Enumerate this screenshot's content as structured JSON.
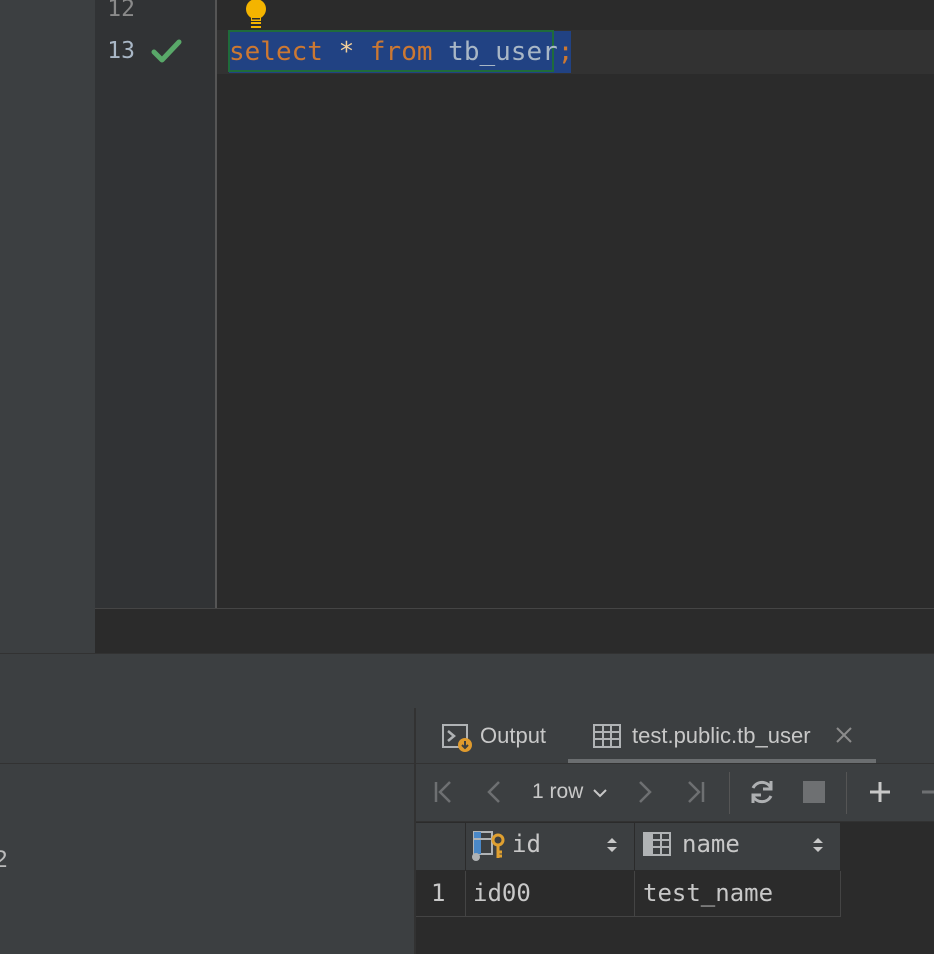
{
  "editor": {
    "line_numbers": [
      "12",
      "13"
    ],
    "code_tokens": [
      {
        "text": "select",
        "kind": "keyword"
      },
      {
        "text": " ",
        "kind": "space"
      },
      {
        "text": "*",
        "kind": "operator"
      },
      {
        "text": " ",
        "kind": "space"
      },
      {
        "text": "from",
        "kind": "keyword"
      },
      {
        "text": " ",
        "kind": "space"
      },
      {
        "text": "tb_user",
        "kind": "identifier"
      },
      {
        "text": ";",
        "kind": "keyword"
      }
    ],
    "gutter_icons": [
      "checkmark-icon",
      "lightbulb-icon"
    ]
  },
  "services_tree": {
    "visible_fragment": "2"
  },
  "results": {
    "tabs": [
      {
        "label": "Output",
        "icon": "console-output-icon"
      },
      {
        "label": "test.public.tb_user",
        "icon": "table-icon",
        "closable": true
      }
    ],
    "toolbar": {
      "rows_label": "1 row",
      "icons": [
        "first-page-icon",
        "prev-page-icon",
        "next-page-icon",
        "last-page-icon",
        "refresh-icon",
        "stop-icon",
        "add-row-icon",
        "remove-row-icon"
      ]
    },
    "columns": [
      {
        "name": "id",
        "icon": "primary-key-column-icon"
      },
      {
        "name": "name",
        "icon": "column-icon"
      }
    ],
    "rows": [
      {
        "row_num": "1",
        "cells": [
          "id00",
          "test_name"
        ]
      }
    ]
  },
  "colors": {
    "keyword": "#cc7832",
    "identifier": "#a9b7c6",
    "selection": "#214283",
    "checkmark": "#59a869",
    "lightbulb": "#f4b400",
    "panel": "#3c3f41",
    "editor_bg": "#2b2b2b"
  }
}
